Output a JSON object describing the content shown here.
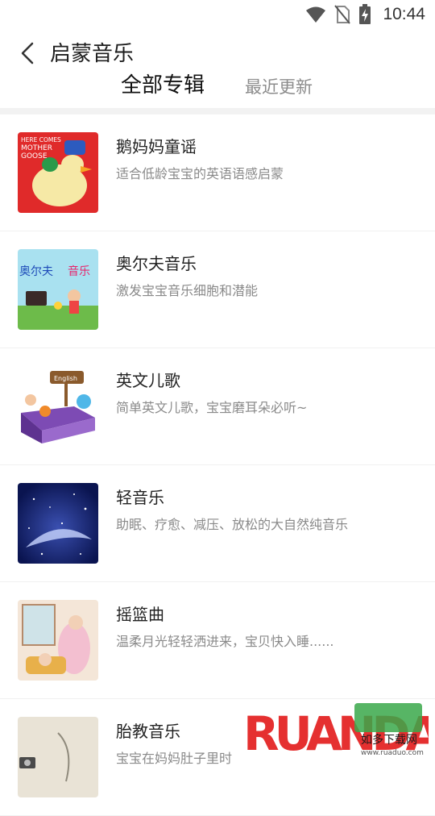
{
  "status": {
    "time": "10:44",
    "icons": [
      "wifi-icon",
      "no-sim-icon",
      "battery-charging-icon"
    ]
  },
  "header": {
    "title": "启蒙音乐",
    "back_icon": "chevron-left-icon"
  },
  "tabs": [
    {
      "label": "全部专辑",
      "active": true
    },
    {
      "label": "最近更新",
      "active": false
    }
  ],
  "albums": [
    {
      "title": "鹅妈妈童谣",
      "desc": "适合低龄宝宝的英语语感启蒙",
      "cover_icon": "mother-goose-cover",
      "cover_text": [
        "HERE COMES",
        "MOTHER",
        "GOOSE"
      ]
    },
    {
      "title": "奥尔夫音乐",
      "desc": "激发宝宝音乐细胞和潜能",
      "cover_icon": "orff-music-cover",
      "cover_text": [
        "奥尔夫",
        "音乐"
      ]
    },
    {
      "title": "英文儿歌",
      "desc": "简单英文儿歌，宝宝磨耳朵必听~",
      "cover_icon": "english-songs-cover",
      "cover_text": [
        "English"
      ]
    },
    {
      "title": "轻音乐",
      "desc": "助眠、疗愈、减压、放松的大自然纯音乐",
      "cover_icon": "night-sky-cover"
    },
    {
      "title": "摇篮曲",
      "desc": "温柔月光轻轻洒进来，宝贝快入睡......",
      "cover_icon": "lullaby-cover"
    },
    {
      "title": "胎教音乐",
      "desc": "宝宝在妈妈肚子里时",
      "cover_icon": "prenatal-cover"
    }
  ],
  "watermark": {
    "brand": "RUANDADO",
    "subtitle": "如多下载网",
    "url": "www.ruaduo.com"
  },
  "colors": {
    "accent_red": "#e23b3b",
    "text_primary": "#222222",
    "text_secondary": "#8a8a8a"
  }
}
